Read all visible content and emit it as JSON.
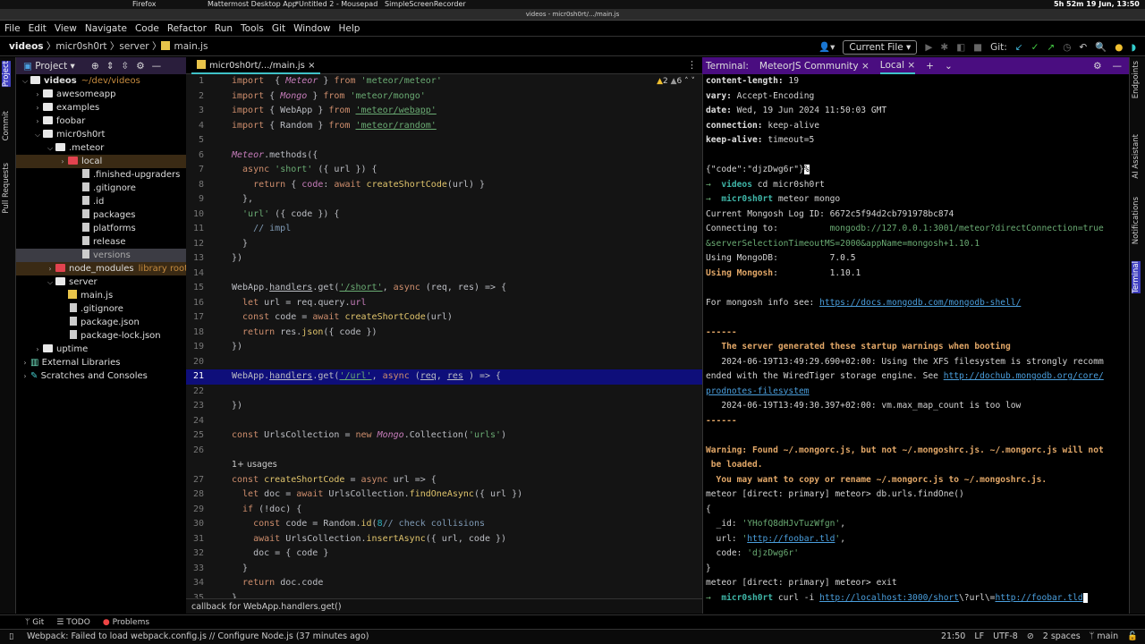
{
  "taskbar": {
    "apps": [
      "Firefox",
      "Mattermost Desktop App",
      "*Untitled 2 - Mousepad",
      "SimpleScreenRecorder"
    ],
    "clock": "5h 52m 19 Jun, 13:50"
  },
  "window": {
    "title": "videos - micr0sh0rt/.../main.js"
  },
  "menu": [
    "File",
    "Edit",
    "View",
    "Navigate",
    "Code",
    "Refactor",
    "Run",
    "Tools",
    "Git",
    "Window",
    "Help"
  ],
  "breadcrumb": [
    "videos",
    "micr0sh0rt",
    "server",
    "main.js"
  ],
  "runbar": {
    "config": "Current File",
    "git_label": "Git:"
  },
  "leftstrip": [
    "Project",
    "Commit",
    "Pull Requests"
  ],
  "rightstrip": [
    "Endpoints",
    "AI Assistant",
    "Notifications",
    "Terminal"
  ],
  "project": {
    "title": "Project",
    "tree": [
      {
        "d": 0,
        "chev": "v",
        "icon": "folder",
        "label": "videos",
        "hint": "~/dev/videos",
        "bold": true
      },
      {
        "d": 1,
        "chev": ">",
        "icon": "folder",
        "label": "awesomeapp"
      },
      {
        "d": 1,
        "chev": ">",
        "icon": "folder",
        "label": "examples"
      },
      {
        "d": 1,
        "chev": ">",
        "icon": "folder",
        "label": "foobar"
      },
      {
        "d": 1,
        "chev": "v",
        "icon": "folder",
        "label": "micr0sh0rt"
      },
      {
        "d": 2,
        "chev": "v",
        "icon": "folder",
        "label": ".meteor"
      },
      {
        "d": 3,
        "chev": ">",
        "icon": "folder-red",
        "label": "local",
        "sel": "sel"
      },
      {
        "d": 4,
        "chev": "",
        "icon": "file",
        "label": ".finished-upgraders"
      },
      {
        "d": 4,
        "chev": "",
        "icon": "file",
        "label": ".gitignore"
      },
      {
        "d": 4,
        "chev": "",
        "icon": "file",
        "label": ".id"
      },
      {
        "d": 4,
        "chev": "",
        "icon": "file",
        "label": "packages"
      },
      {
        "d": 4,
        "chev": "",
        "icon": "file",
        "label": "platforms"
      },
      {
        "d": 4,
        "chev": "",
        "icon": "file",
        "label": "release"
      },
      {
        "d": 4,
        "chev": "",
        "icon": "file",
        "label": "versions",
        "sel": "sel2"
      },
      {
        "d": 2,
        "chev": ">",
        "icon": "folder-red",
        "label": "node_modules",
        "hint": "library root",
        "sel": "sel"
      },
      {
        "d": 2,
        "chev": "v",
        "icon": "folder",
        "label": "server"
      },
      {
        "d": 3,
        "chev": "",
        "icon": "js",
        "label": "main.js"
      },
      {
        "d": 3,
        "chev": "",
        "icon": "file",
        "label": ".gitignore"
      },
      {
        "d": 3,
        "chev": "",
        "icon": "file",
        "label": "package.json"
      },
      {
        "d": 3,
        "chev": "",
        "icon": "file",
        "label": "package-lock.json"
      },
      {
        "d": 1,
        "chev": ">",
        "icon": "folder",
        "label": "uptime"
      },
      {
        "d": 0,
        "chev": ">",
        "icon": "lib",
        "label": "External Libraries"
      },
      {
        "d": 0,
        "chev": ">",
        "icon": "scratch",
        "label": "Scratches and Consoles"
      }
    ]
  },
  "editor": {
    "tab": "micr0sh0rt/.../main.js",
    "warnings": "2",
    "weak_warnings": "6",
    "footer": "callback for WebApp.handlers.get()",
    "lines": [
      {
        "n": "1",
        "t": [
          [
            "k",
            "import"
          ],
          [
            "",
            "  { "
          ],
          [
            "i",
            "Meteor"
          ],
          [
            "",
            " } "
          ],
          [
            "k",
            "from"
          ],
          [
            "",
            " "
          ],
          [
            "s",
            "'meteor/meteor'"
          ]
        ]
      },
      {
        "n": "2",
        "t": [
          [
            "k",
            "import"
          ],
          [
            "",
            " { "
          ],
          [
            "i",
            "Mongo"
          ],
          [
            "",
            " } "
          ],
          [
            "k",
            "from"
          ],
          [
            "",
            " "
          ],
          [
            "s",
            "'meteor/mongo'"
          ]
        ]
      },
      {
        "n": "3",
        "t": [
          [
            "k",
            "import"
          ],
          [
            "",
            " { WebApp } "
          ],
          [
            "k",
            "from"
          ],
          [
            "",
            " "
          ],
          [
            "su",
            "'meteor/webapp'"
          ]
        ]
      },
      {
        "n": "4",
        "t": [
          [
            "k",
            "import"
          ],
          [
            "",
            " { Random } "
          ],
          [
            "k",
            "from"
          ],
          [
            "",
            " "
          ],
          [
            "su",
            "'meteor/random'"
          ]
        ]
      },
      {
        "n": "5",
        "t": []
      },
      {
        "n": "6",
        "t": [
          [
            "i",
            "Meteor"
          ],
          [
            "",
            ".methods({"
          ]
        ]
      },
      {
        "n": "7",
        "t": [
          [
            "k",
            "  async "
          ],
          [
            "s",
            "'short'"
          ],
          [
            "",
            " ({ url }) {"
          ]
        ]
      },
      {
        "n": "8",
        "t": [
          [
            "k",
            "    return"
          ],
          [
            "",
            " { "
          ],
          [
            "p",
            "code"
          ],
          [
            "",
            ": "
          ],
          [
            "k",
            "await "
          ],
          [
            "f",
            "createShortCode"
          ],
          [
            "",
            "(url) }"
          ]
        ]
      },
      {
        "n": "9",
        "t": [
          [
            "",
            "  },"
          ]
        ]
      },
      {
        "n": "10",
        "t": [
          [
            "s",
            "  'url'"
          ],
          [
            "",
            " ({ code }) {"
          ]
        ]
      },
      {
        "n": "11",
        "t": [
          [
            "c",
            "    // impl"
          ]
        ]
      },
      {
        "n": "12",
        "t": [
          [
            "",
            "  }"
          ]
        ]
      },
      {
        "n": "13",
        "t": [
          [
            "",
            "})"
          ]
        ]
      },
      {
        "n": "14",
        "t": []
      },
      {
        "n": "15",
        "t": [
          [
            "",
            "WebApp."
          ],
          [
            "u",
            "handlers"
          ],
          [
            "",
            ".get("
          ],
          [
            "su",
            "'/short'"
          ],
          [
            "",
            ", "
          ],
          [
            "k",
            "async"
          ],
          [
            "",
            " (req, res) => {"
          ]
        ]
      },
      {
        "n": "16",
        "t": [
          [
            "k",
            "  let"
          ],
          [
            "",
            " url = req.query."
          ],
          [
            "p",
            "url"
          ]
        ]
      },
      {
        "n": "17",
        "t": [
          [
            "k",
            "  const"
          ],
          [
            "",
            " code = "
          ],
          [
            "k",
            "await "
          ],
          [
            "f",
            "createShortCode"
          ],
          [
            "",
            "(url)"
          ]
        ]
      },
      {
        "n": "18",
        "t": [
          [
            "k",
            "  return"
          ],
          [
            "",
            " res."
          ],
          [
            "f",
            "json"
          ],
          [
            "",
            "({ code })"
          ]
        ]
      },
      {
        "n": "19",
        "t": [
          [
            "",
            "})"
          ]
        ]
      },
      {
        "n": "20",
        "t": []
      },
      {
        "n": "21",
        "t": [
          [
            "",
            "WebApp."
          ],
          [
            "u",
            "handlers"
          ],
          [
            "",
            ".get("
          ],
          [
            "su",
            "'/url'"
          ],
          [
            "",
            ", "
          ],
          [
            "k",
            "async"
          ],
          [
            "",
            " ("
          ],
          [
            "u",
            "req"
          ],
          [
            "",
            ", "
          ],
          [
            "u",
            "res"
          ],
          [
            "",
            " ) => {"
          ]
        ],
        "hl": true
      },
      {
        "n": "22",
        "t": []
      },
      {
        "n": "23",
        "t": [
          [
            "",
            "})"
          ]
        ]
      },
      {
        "n": "24",
        "t": []
      },
      {
        "n": "25",
        "t": [
          [
            "k",
            "const"
          ],
          [
            "",
            " UrlsCollection = "
          ],
          [
            "k",
            "new "
          ],
          [
            "i",
            "Mongo"
          ],
          [
            "",
            ".Collection("
          ],
          [
            "s",
            "'urls'"
          ],
          [
            "",
            ")"
          ]
        ]
      },
      {
        "n": "26",
        "t": []
      },
      {
        "n": "",
        "usages": "1+ usages",
        "t": []
      },
      {
        "n": "27",
        "t": [
          [
            "k",
            "const "
          ],
          [
            "f",
            "createShortCode"
          ],
          [
            "",
            " = "
          ],
          [
            "k",
            "async"
          ],
          [
            "",
            " url => {"
          ]
        ]
      },
      {
        "n": "28",
        "t": [
          [
            "k",
            "  let"
          ],
          [
            "",
            " doc = "
          ],
          [
            "k",
            "await"
          ],
          [
            "",
            " UrlsCollection."
          ],
          [
            "f",
            "findOneAsync"
          ],
          [
            "",
            "({ url })"
          ]
        ]
      },
      {
        "n": "29",
        "t": [
          [
            "k",
            "  if"
          ],
          [
            "",
            " (!doc) {"
          ]
        ]
      },
      {
        "n": "30",
        "t": [
          [
            "k",
            "    const"
          ],
          [
            "",
            " code = Random."
          ],
          [
            "f",
            "id"
          ],
          [
            "",
            "("
          ],
          [
            "n",
            "8"
          ],
          [
            ") "
          ],
          [
            "c",
            "// check collisions"
          ]
        ]
      },
      {
        "n": "31",
        "t": [
          [
            "k",
            "    await"
          ],
          [
            "",
            " UrlsCollection."
          ],
          [
            "f",
            "insertAsync"
          ],
          [
            "",
            "({ url, code })"
          ]
        ]
      },
      {
        "n": "32",
        "t": [
          [
            "",
            "    doc = { code }"
          ]
        ]
      },
      {
        "n": "33",
        "t": [
          [
            "",
            "  }"
          ]
        ]
      },
      {
        "n": "34",
        "t": [
          [
            "k",
            "  return"
          ],
          [
            "",
            " doc.code"
          ]
        ]
      },
      {
        "n": "35",
        "t": [
          [
            "",
            "}"
          ]
        ]
      }
    ]
  },
  "terminal": {
    "label": "Terminal:",
    "tabs": [
      "MeteorJS Community",
      "Local"
    ],
    "lines": [
      [
        [
          "b",
          "content-length:"
        ],
        [
          "",
          " 19"
        ]
      ],
      [
        [
          "b",
          "vary:"
        ],
        [
          "",
          " Accept-Encoding"
        ]
      ],
      [
        [
          "b",
          "date:"
        ],
        [
          "",
          " Wed, 19 Jun 2024 11:50:03 GMT"
        ]
      ],
      [
        [
          "b",
          "connection:"
        ],
        [
          "",
          " keep-alive"
        ]
      ],
      [
        [
          "b",
          "keep-alive:"
        ],
        [
          "",
          " timeout=5"
        ]
      ],
      [],
      [
        [
          "",
          "{\"code\":\"djzDwg6r\"}"
        ],
        [
          "cur",
          "%"
        ]
      ],
      [
        [
          "ar",
          "→  "
        ],
        [
          "cy",
          "videos"
        ],
        [
          "",
          " cd micr0sh0rt"
        ]
      ],
      [
        [
          "ar",
          "→  "
        ],
        [
          "cy",
          "micr0sh0rt"
        ],
        [
          "",
          " meteor mongo"
        ]
      ],
      [
        [
          "",
          "Current Mongosh Log ID: 6672c5f94d2cb791978bc874"
        ]
      ],
      [
        [
          "",
          "Connecting to:          "
        ],
        [
          "g",
          "mongodb://127.0.0.1:3001/meteor?directConnection=true"
        ]
      ],
      [
        [
          "g",
          "&serverSelectionTimeoutMS=2000&appName=mongosh+1.10.1"
        ]
      ],
      [
        [
          "",
          "Using MongoDB:          7.0.5"
        ]
      ],
      [
        [
          "o",
          "Using Mongosh"
        ],
        [
          "",
          ":          1.10.1"
        ]
      ],
      [],
      [
        [
          "",
          "For mongosh info see: "
        ],
        [
          "u",
          "https://docs.mongodb.com/mongodb-shell/"
        ]
      ],
      [],
      [
        [
          "o",
          "------"
        ]
      ],
      [
        [
          "o",
          "   The server generated these startup warnings when booting"
        ]
      ],
      [
        [
          "",
          "   2024-06-19T13:49:29.690+02:00: Using the XFS filesystem is strongly recomm"
        ]
      ],
      [
        [
          "",
          "ended with the WiredTiger storage engine. See "
        ],
        [
          "u",
          "http://dochub.mongodb.org/core/"
        ]
      ],
      [
        [
          "u",
          "prodnotes-filesystem"
        ]
      ],
      [
        [
          "",
          "   2024-06-19T13:49:30.397+02:00: vm.max_map_count is too low"
        ]
      ],
      [
        [
          "o",
          "------"
        ]
      ],
      [],
      [
        [
          "o",
          "Warning: Found ~/.mongorc.js, but not ~/.mongoshrc.js. ~/.mongorc.js will not"
        ]
      ],
      [
        [
          "o",
          " be loaded."
        ]
      ],
      [
        [
          "o",
          "  You may want to copy or rename ~/.mongorc.js to ~/.mongoshrc.js."
        ]
      ],
      [
        [
          "",
          "meteor [direct: primary] meteor> db.urls.findOne()"
        ]
      ],
      [
        [
          "",
          "{"
        ]
      ],
      [
        [
          "",
          "  _id: "
        ],
        [
          "g",
          "'YHofQ8dHJvTuzWfgn'"
        ],
        [
          "",
          ","
        ]
      ],
      [
        [
          "",
          "  url: "
        ],
        [
          "g",
          "'"
        ],
        [
          "u",
          "http://foobar.tld"
        ],
        [
          "g",
          "'"
        ],
        [
          "",
          ","
        ]
      ],
      [
        [
          "",
          "  code: "
        ],
        [
          "g",
          "'djzDwg6r'"
        ]
      ],
      [
        [
          "",
          "}"
        ]
      ],
      [
        [
          "",
          "meteor [direct: primary] meteor> exit"
        ]
      ],
      [
        [
          "ar",
          "→  "
        ],
        [
          "cy",
          "micr0sh0rt"
        ],
        [
          "",
          " curl -i "
        ],
        [
          "u",
          "http://localhost:3000/short"
        ],
        [
          "",
          "\\?url\\="
        ],
        [
          "u",
          "http://foobar.tld"
        ],
        [
          "cur",
          " "
        ]
      ]
    ]
  },
  "bottom_tabs": [
    "Git",
    "TODO",
    "Problems"
  ],
  "status": {
    "message": "Webpack: Failed to load webpack.config.js // Configure Node.js (37 minutes ago)",
    "position": "21:50",
    "line_sep": "LF",
    "encoding": "UTF-8",
    "indent": "2 spaces",
    "branch": "main"
  },
  "colors": {
    "accent": "#3fc2c8",
    "terminal_header": "#4a0d80",
    "selected_line": "#0e0e7a"
  }
}
